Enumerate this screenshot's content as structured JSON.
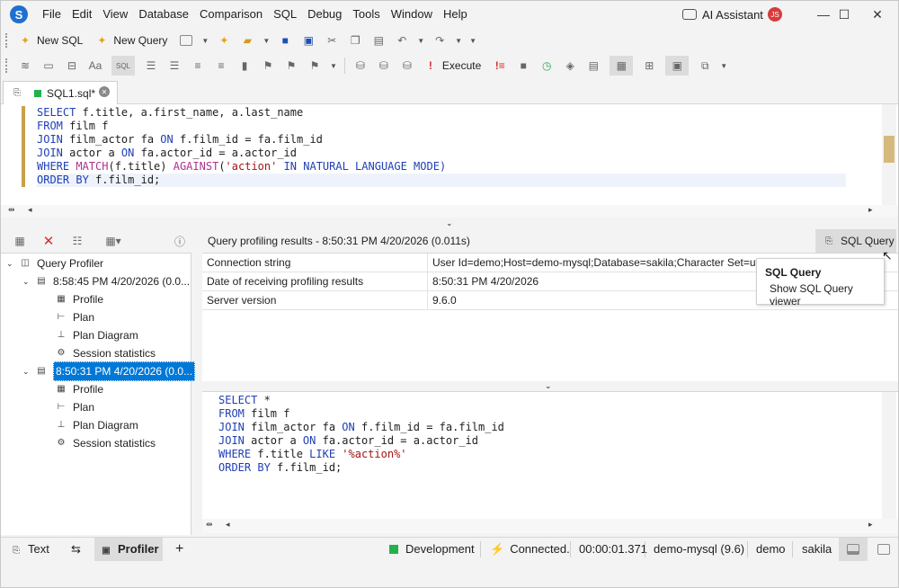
{
  "menu": [
    "File",
    "Edit",
    "View",
    "Database",
    "Comparison",
    "SQL",
    "Debug",
    "Tools",
    "Window",
    "Help"
  ],
  "ai_assistant": "AI Assistant",
  "avatar": "JS",
  "toolbar1": {
    "new_sql": "New SQL",
    "new_query": "New Query"
  },
  "toolbar2": {
    "execute": "Execute"
  },
  "tab": {
    "title": "SQL1.sql*"
  },
  "editor_top": {
    "lines": [
      [
        {
          "t": "SELECT ",
          "c": "kw"
        },
        {
          "t": "f.title, a.first_name, a.last_name",
          "c": ""
        }
      ],
      [
        {
          "t": "FROM ",
          "c": "kw"
        },
        {
          "t": "film f",
          "c": ""
        }
      ],
      [
        {
          "t": "JOIN ",
          "c": "kw"
        },
        {
          "t": "film_actor fa ",
          "c": ""
        },
        {
          "t": "ON ",
          "c": "kw"
        },
        {
          "t": "f.film_id = fa.film_id",
          "c": ""
        }
      ],
      [
        {
          "t": "JOIN ",
          "c": "kw"
        },
        {
          "t": "actor a ",
          "c": ""
        },
        {
          "t": "ON ",
          "c": "kw"
        },
        {
          "t": "fa.actor_id = a.actor_id",
          "c": ""
        }
      ],
      [
        {
          "t": "WHERE ",
          "c": "kw"
        },
        {
          "t": "MATCH",
          "c": "fn"
        },
        {
          "t": "(f.title) ",
          "c": ""
        },
        {
          "t": "AGAINST",
          "c": "fn"
        },
        {
          "t": "(",
          "c": ""
        },
        {
          "t": "'action'",
          "c": "str"
        },
        {
          "t": " IN NATURAL LANGUAGE MODE)",
          "c": "kw"
        }
      ],
      [
        {
          "t": "ORDER BY ",
          "c": "kw"
        },
        {
          "t": "f.film_id;",
          "c": ""
        }
      ]
    ]
  },
  "profiler_tree": {
    "root": "Query Profiler",
    "sessions": [
      {
        "label": "8:58:45 PM 4/20/2026 (0.0...",
        "selected": false,
        "children": [
          "Profile",
          "Plan",
          "Plan Diagram",
          "Session statistics"
        ]
      },
      {
        "label": "8:50:31 PM 4/20/2026 (0.0...",
        "selected": true,
        "children": [
          "Profile",
          "Plan",
          "Plan Diagram",
          "Session statistics"
        ]
      }
    ]
  },
  "results": {
    "header": "Query profiling results - 8:50:31 PM 4/20/2026 (0.011s)",
    "sql_query_button": "SQL Query",
    "rows": [
      {
        "name": "Connection string",
        "value": "User Id=demo;Host=demo-mysql;Database=sakila;Character Set=utf8"
      },
      {
        "name": "Date of receiving profiling results",
        "value": "8:50:31 PM 4/20/2026"
      },
      {
        "name": "Server version",
        "value": "9.6.0"
      }
    ]
  },
  "tooltip": {
    "title": "SQL Query",
    "text": "Show SQL Query viewer"
  },
  "editor_bottom": {
    "lines": [
      [
        {
          "t": "SELECT ",
          "c": "kw"
        },
        {
          "t": "*",
          "c": ""
        }
      ],
      [
        {
          "t": "FROM ",
          "c": "kw"
        },
        {
          "t": "film f",
          "c": ""
        }
      ],
      [
        {
          "t": "JOIN ",
          "c": "kw"
        },
        {
          "t": "film_actor fa ",
          "c": ""
        },
        {
          "t": "ON ",
          "c": "kw"
        },
        {
          "t": "f.film_id = fa.film_id",
          "c": ""
        }
      ],
      [
        {
          "t": "JOIN ",
          "c": "kw"
        },
        {
          "t": "actor a ",
          "c": ""
        },
        {
          "t": "ON ",
          "c": "kw"
        },
        {
          "t": "fa.actor_id = a.actor_id",
          "c": ""
        }
      ],
      [
        {
          "t": "WHERE ",
          "c": "kw"
        },
        {
          "t": "f.title ",
          "c": ""
        },
        {
          "t": "LIKE ",
          "c": "kw"
        },
        {
          "t": "'%action%'",
          "c": "str"
        }
      ],
      [
        {
          "t": "ORDER BY ",
          "c": "kw"
        },
        {
          "t": "f.film_id;",
          "c": ""
        }
      ]
    ]
  },
  "bottom_tabs": {
    "text": "Text",
    "profiler": "Profiler"
  },
  "status": {
    "env": "Development",
    "connected": "Connected.",
    "time": "00:00:01.371",
    "server": "demo-mysql (9.6)",
    "user": "demo",
    "db": "sakila"
  },
  "colors": {
    "accent": "#1f6fd1",
    "selected": "#0078d7",
    "env": "#22b14c",
    "keyword": "#1f3fb5",
    "function": "#b0308f",
    "string": "#a31515"
  }
}
